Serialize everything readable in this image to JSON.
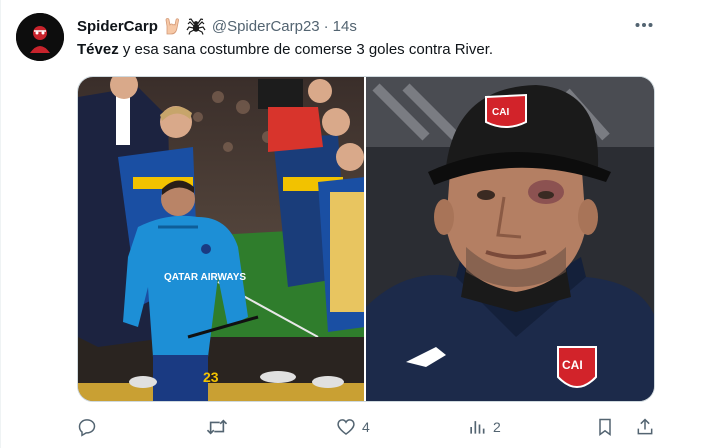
{
  "user": {
    "display_name": "SpiderCarp",
    "emojis": [
      "hand-rock-icon",
      "spider-icon"
    ],
    "handle": "@SpiderCarp23",
    "separator": "·",
    "timestamp": "14s"
  },
  "tweet": {
    "bold_text": "Tévez",
    "text": " y esa sana costumbre de comerse 3 goles contra River."
  },
  "media": {
    "left_photo": {
      "sponsor": "QATAR AIRWAYS",
      "jersey_number": "23"
    },
    "right_photo": {
      "cap_logo": "CAI",
      "jacket_logo": "CAI"
    }
  },
  "actions": {
    "reply_count": "",
    "retweet_count": "",
    "like_count": "4",
    "views_count": "2"
  },
  "colors": {
    "text": "#0f1419",
    "secondary": "#536471",
    "boca_blue": "#1a4fa3",
    "boca_gold": "#f2c200",
    "independiente_red": "#d2232a"
  }
}
